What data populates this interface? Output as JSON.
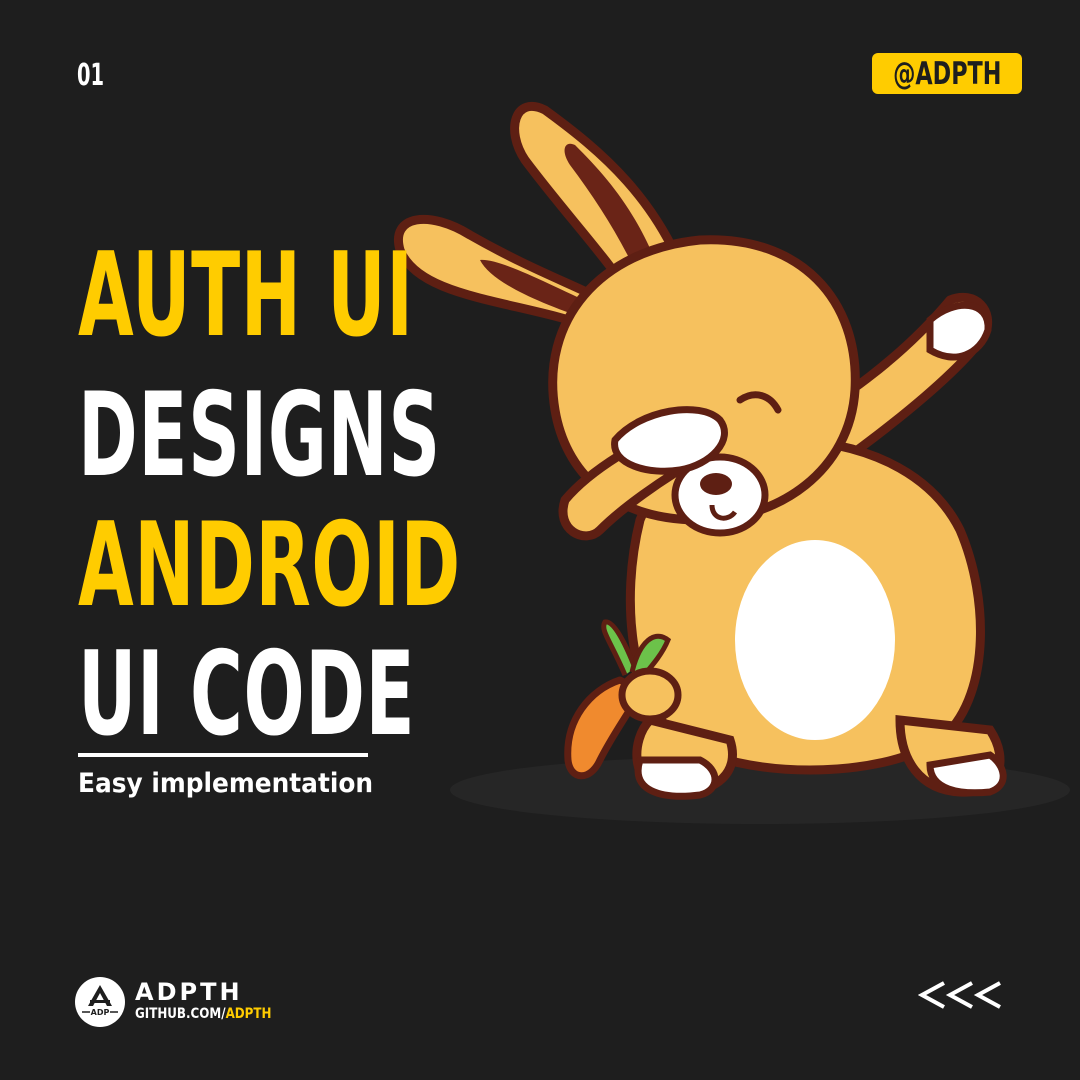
{
  "slide_number": "01",
  "handle": "@ADPTH",
  "headline": {
    "line1": "AUTH UI",
    "line2": "DESIGNS",
    "line3": "ANDROID",
    "line4": "UI CODE"
  },
  "tagline": "Easy implementation",
  "brand": {
    "name": "ADPTH",
    "logo_text": "ADP",
    "url_prefix": "GITHUB.COM/",
    "url_user": "ADPTH"
  },
  "icons": {
    "mascot": "dabbing-bunny-with-carrot-illustration",
    "logo": "adpth-logo-icon",
    "arrows": "triple-chevron-left-icon"
  },
  "colors": {
    "background": "#1e1e1e",
    "accent": "#ffcc00",
    "text": "#ffffff"
  }
}
